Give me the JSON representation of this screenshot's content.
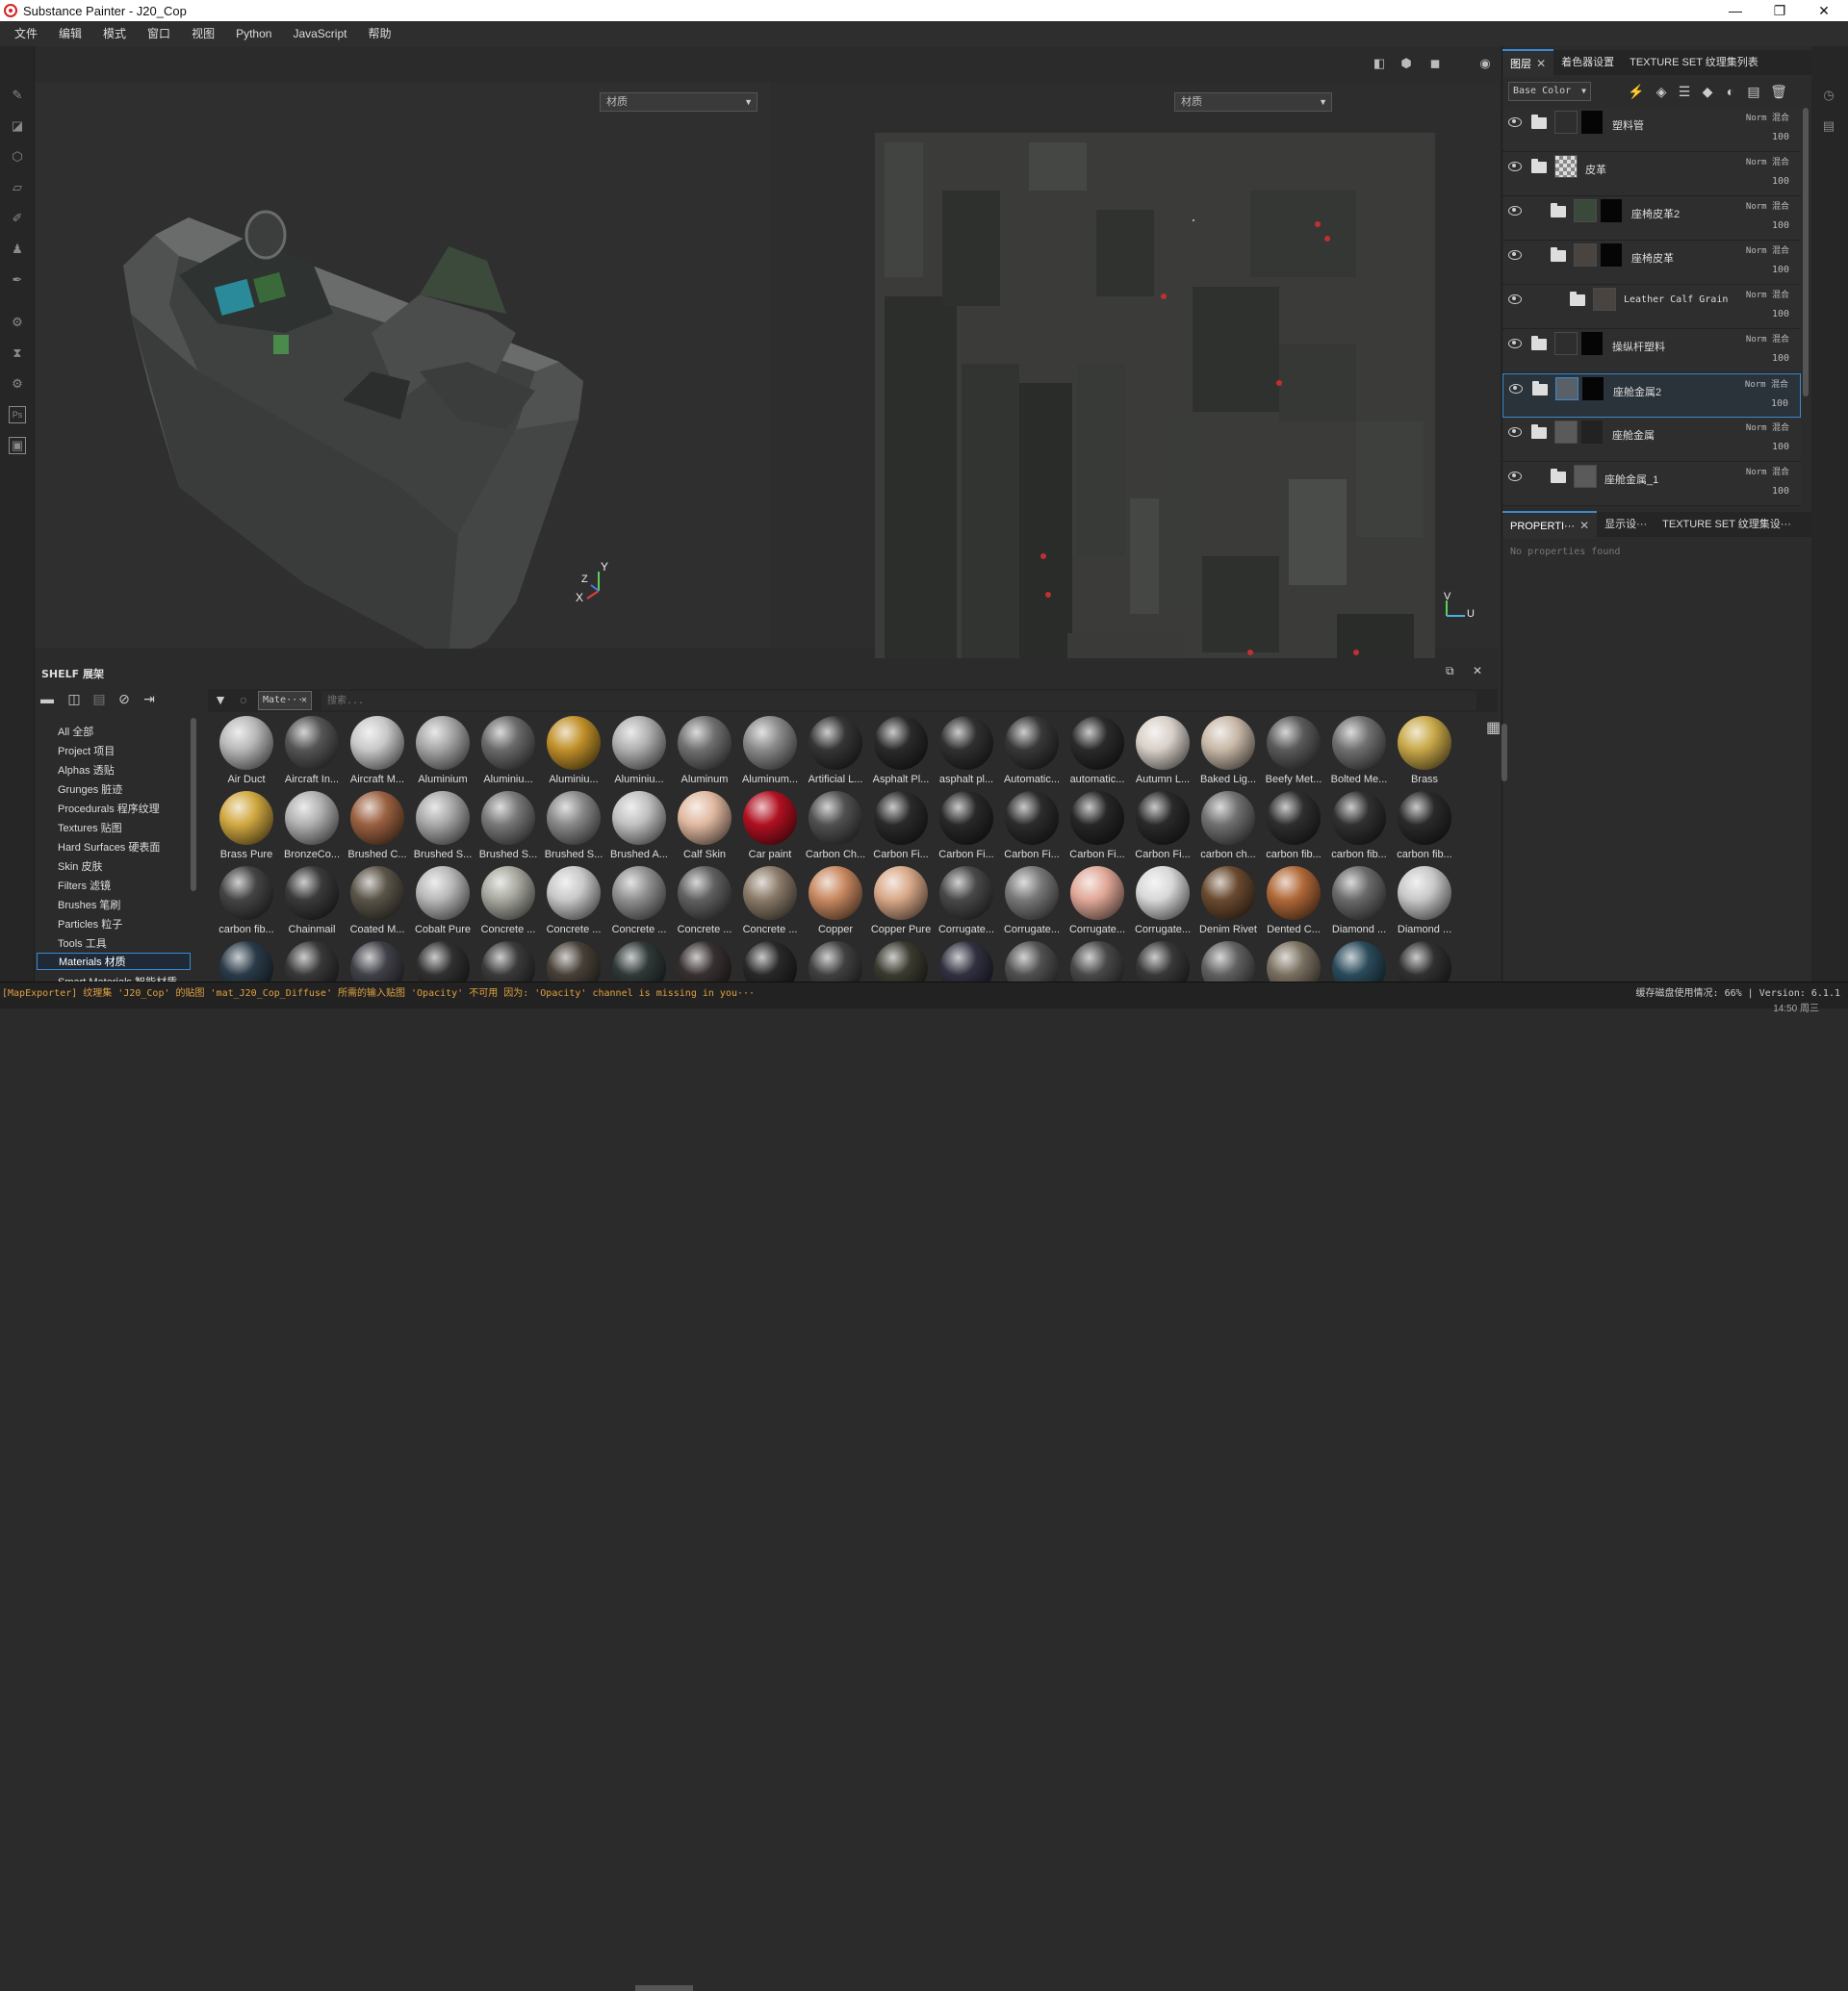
{
  "window": {
    "title": "Substance Painter - J20_Cop",
    "minimize": "—",
    "maximize": "❐",
    "close": "✕"
  },
  "menu": [
    "文件",
    "编辑",
    "模式",
    "窗口",
    "视图",
    "Python",
    "JavaScript",
    "帮助"
  ],
  "viewport": {
    "left_dropdown": "材质",
    "right_dropdown": "材质",
    "axis_3d": {
      "y": "Y",
      "z": "Z",
      "x": "X"
    },
    "axis_2d": {
      "v": "V",
      "u": "U"
    }
  },
  "right_panel": {
    "tabs_top": [
      "图层",
      "着色器设置",
      "TEXTURE SET 纹理集列表"
    ],
    "channel": "Base Color",
    "layers": [
      {
        "name": "塑料管",
        "blend": "Norm 混合",
        "opacity": "100"
      },
      {
        "name": "皮革",
        "blend": "Norm 混合",
        "opacity": "100"
      },
      {
        "name": "座椅皮革2",
        "blend": "Norm 混合",
        "opacity": "100"
      },
      {
        "name": "座椅皮革",
        "blend": "Norm 混合",
        "opacity": "100"
      },
      {
        "name": "Leather Calf Grain",
        "blend": "Norm 混合",
        "opacity": "100"
      },
      {
        "name": "操纵杆塑料",
        "blend": "Norm 混合",
        "opacity": "100"
      },
      {
        "name": "座舱金属2",
        "blend": "Norm 混合",
        "opacity": "100"
      },
      {
        "name": "座舱金属",
        "blend": "Norm 混合",
        "opacity": "100"
      },
      {
        "name": "座舱金属_1",
        "blend": "Norm 混合",
        "opacity": "100"
      }
    ],
    "tabs_props": [
      "PROPERTI···",
      "显示设···",
      "TEXTURE SET 纹理集设···"
    ],
    "props_empty": "No properties found"
  },
  "shelf": {
    "title": "SHELF 展架",
    "filter_chip": "Mate···",
    "search_placeholder": "搜索...",
    "categories": [
      "All 全部",
      "Project 项目",
      "Alphas 透贴",
      "Grunges 脏迹",
      "Procedurals 程序纹理",
      "Textures 贴图",
      "Hard Surfaces 硬表面",
      "Skin 皮肤",
      "Filters 滤镜",
      "Brushes 笔刷",
      "Particles 粒子",
      "Tools 工具",
      "Materials 材质",
      "Smart Materials 智能材质"
    ],
    "active_category": "Materials 材质",
    "materials": [
      {
        "label": "Air Duct",
        "color": "#b8b8b8"
      },
      {
        "label": "Aircraft In...",
        "color": "#555555"
      },
      {
        "label": "Aircraft M...",
        "color": "#c8c8c8"
      },
      {
        "label": "Aluminium",
        "color": "#a6a6a6"
      },
      {
        "label": "Aluminiu...",
        "color": "#6a6a6a"
      },
      {
        "label": "Aluminiu...",
        "color": "#c0902a"
      },
      {
        "label": "Aluminiu...",
        "color": "#b0b0b0"
      },
      {
        "label": "Aluminum",
        "color": "#707070"
      },
      {
        "label": "Aluminum...",
        "color": "#8a8a8a"
      },
      {
        "label": "Artificial L...",
        "color": "#353535"
      },
      {
        "label": "Asphalt Pl...",
        "color": "#2a2a2a"
      },
      {
        "label": "asphalt pl...",
        "color": "#303030"
      },
      {
        "label": "Automatic...",
        "color": "#383838"
      },
      {
        "label": "automatic...",
        "color": "#2a2a2a"
      },
      {
        "label": "Autumn L...",
        "color": "#d8d0c8"
      },
      {
        "label": "Baked Lig...",
        "color": "#c8b8a8"
      },
      {
        "label": "Beefy Met...",
        "color": "#5a5a5a"
      },
      {
        "label": "Bolted Me...",
        "color": "#707070"
      },
      {
        "label": "Brass",
        "color": "#c8a848"
      },
      {
        "label": "Brass Pure",
        "color": "#d0a840"
      },
      {
        "label": "BronzeCo...",
        "color": "#b0b0b0"
      },
      {
        "label": "Brushed C...",
        "color": "#9a6040"
      },
      {
        "label": "Brushed S...",
        "color": "#a8a8a8"
      },
      {
        "label": "Brushed S...",
        "color": "#787878"
      },
      {
        "label": "Brushed S...",
        "color": "#888888"
      },
      {
        "label": "Brushed A...",
        "color": "#c0c0c0"
      },
      {
        "label": "Calf Skin",
        "color": "#e0b8a0"
      },
      {
        "label": "Car paint",
        "color": "#b01020"
      },
      {
        "label": "Carbon Ch...",
        "color": "#505050"
      },
      {
        "label": "Carbon Fi...",
        "color": "#2a2a2a"
      },
      {
        "label": "Carbon Fi...",
        "color": "#282828"
      },
      {
        "label": "Carbon Fi...",
        "color": "#2c2c2c"
      },
      {
        "label": "Carbon Fi...",
        "color": "#262626"
      },
      {
        "label": "Carbon Fi...",
        "color": "#2a2a2a"
      },
      {
        "label": "carbon ch...",
        "color": "#707070"
      },
      {
        "label": "carbon fib...",
        "color": "#2e2e2e"
      },
      {
        "label": "carbon fib...",
        "color": "#303030"
      },
      {
        "label": "carbon fib...",
        "color": "#2a2a2a"
      },
      {
        "label": "carbon fib...",
        "color": "#444444"
      },
      {
        "label": "Chainmail",
        "color": "#3a3a3a"
      },
      {
        "label": "Coated M...",
        "color": "#5a5448"
      },
      {
        "label": "Cobalt Pure",
        "color": "#b8b8b8"
      },
      {
        "label": "Concrete ...",
        "color": "#a8a8a0"
      },
      {
        "label": "Concrete ...",
        "color": "#c8c8c8"
      },
      {
        "label": "Concrete ...",
        "color": "#909090"
      },
      {
        "label": "Concrete ...",
        "color": "#606060"
      },
      {
        "label": "Concrete ...",
        "color": "#8a7a68"
      },
      {
        "label": "Copper",
        "color": "#c88860"
      },
      {
        "label": "Copper Pure",
        "color": "#d8a888"
      },
      {
        "label": "Corrugate...",
        "color": "#484848"
      },
      {
        "label": "Corrugate...",
        "color": "#787878"
      },
      {
        "label": "Corrugate...",
        "color": "#e0a898"
      },
      {
        "label": "Corrugate...",
        "color": "#d8d8d8"
      },
      {
        "label": "Denim Rivet",
        "color": "#6a4a30"
      },
      {
        "label": "Dented C...",
        "color": "#b06838"
      },
      {
        "label": "Diamond ...",
        "color": "#6a6a6a"
      },
      {
        "label": "Diamond ...",
        "color": "#c8c8c8"
      },
      {
        "label": "",
        "color": "#2a3a48"
      },
      {
        "label": "",
        "color": "#383838"
      },
      {
        "label": "",
        "color": "#404048"
      },
      {
        "label": "",
        "color": "#303030"
      },
      {
        "label": "",
        "color": "#3a3a3a"
      },
      {
        "label": "",
        "color": "#484038"
      },
      {
        "label": "",
        "color": "#303838"
      },
      {
        "label": "",
        "color": "#383030"
      },
      {
        "label": "",
        "color": "#282828"
      },
      {
        "label": "",
        "color": "#404040"
      },
      {
        "label": "",
        "color": "#3a3a30"
      },
      {
        "label": "",
        "color": "#303040"
      },
      {
        "label": "",
        "color": "#505050"
      },
      {
        "label": "",
        "color": "#484848"
      },
      {
        "label": "",
        "color": "#383838"
      },
      {
        "label": "",
        "color": "#606060"
      },
      {
        "label": "",
        "color": "#7a7060"
      },
      {
        "label": "",
        "color": "#2a4a5a"
      },
      {
        "label": "",
        "color": "#303030"
      }
    ]
  },
  "status": {
    "message": "[MapExporter] 纹理集 'J20_Cop' 的贴图 'mat_J20_Cop_Diffuse' 所需的输入贴图 'Opacity' 不可用 因为: 'Opacity' channel is missing in you···",
    "disk": "缓存磁盘使用情况: 66% | Version: 6.1.1",
    "extra": "14:50 周三"
  }
}
